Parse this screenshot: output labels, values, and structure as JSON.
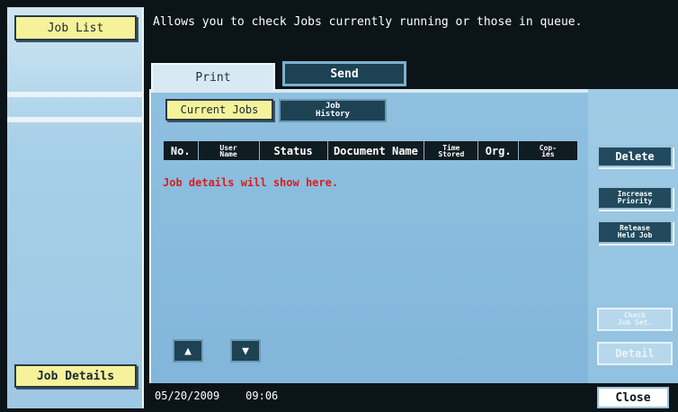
{
  "header": {
    "description": "Allows you to check Jobs currently running or those in queue."
  },
  "sidebar": {
    "job_list_label": "Job List",
    "job_details_label": "Job Details"
  },
  "tabs": {
    "print": "Print",
    "send": "Send"
  },
  "subtabs": {
    "current_jobs": "Current Jobs",
    "job_history": "Job\nHistory"
  },
  "table": {
    "columns": [
      "No.",
      "User\nName",
      "Status",
      "Document Name",
      "Time\nStored",
      "Org.",
      "Cop-\nies"
    ],
    "empty_message": "Job details will show here."
  },
  "actions": {
    "delete": "Delete",
    "increase_priority": "Increase\nPriority",
    "release_held_job": "Release\nHeld Job",
    "check_job_set": "Check\nJob Set.",
    "detail": "Detail",
    "close": "Close"
  },
  "scroll": {
    "up_icon": "▲",
    "down_icon": "▼"
  },
  "status_bar": {
    "date": "05/20/2009",
    "time": "09:06"
  },
  "colors": {
    "panel": "#8fc0e0",
    "button_dark": "#214a5e",
    "accent_yellow": "#f5f29a",
    "error_text": "#d42020"
  }
}
